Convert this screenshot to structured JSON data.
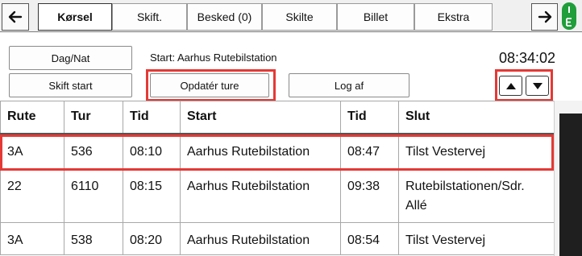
{
  "tabs": [
    {
      "label": "Kørsel",
      "active": true
    },
    {
      "label": "Skift.",
      "active": false
    },
    {
      "label": "Besked (0)",
      "active": false
    },
    {
      "label": "Skilte",
      "active": false
    },
    {
      "label": "Billet",
      "active": false
    },
    {
      "label": "Ekstra",
      "active": false
    }
  ],
  "nav": {
    "back_icon": "arrow-left-icon",
    "forward_icon": "arrow-right-icon"
  },
  "status_icon": "traffic-light-icon",
  "controls": {
    "day_night": "Dag/Nat",
    "start_info": "Start: Aarhus Rutebilstation",
    "clock": "08:34:02",
    "change_start": "Skift start",
    "update_trips": "Opdatér ture",
    "logout": "Log af",
    "up_icon": "caret-up-icon",
    "down_icon": "caret-down-icon"
  },
  "table": {
    "headers": [
      "Rute",
      "Tur",
      "Tid",
      "Start",
      "Tid",
      "Slut"
    ],
    "rows": [
      [
        "3A",
        "536",
        "08:10",
        "Aarhus Rutebilstation",
        "08:47",
        "Tilst Vestervej"
      ],
      [
        "22",
        "6110",
        "08:15",
        "Aarhus Rutebilstation",
        "09:38",
        "Rutebilstationen/Sdr. Allé"
      ],
      [
        "3A",
        "538",
        "08:20",
        "Aarhus Rutebilstation",
        "08:54",
        "Tilst Vestervej"
      ]
    ],
    "highlighted_row": 0
  },
  "colors": {
    "highlight": "#e53935",
    "signal_green": "#1f9e3a"
  }
}
